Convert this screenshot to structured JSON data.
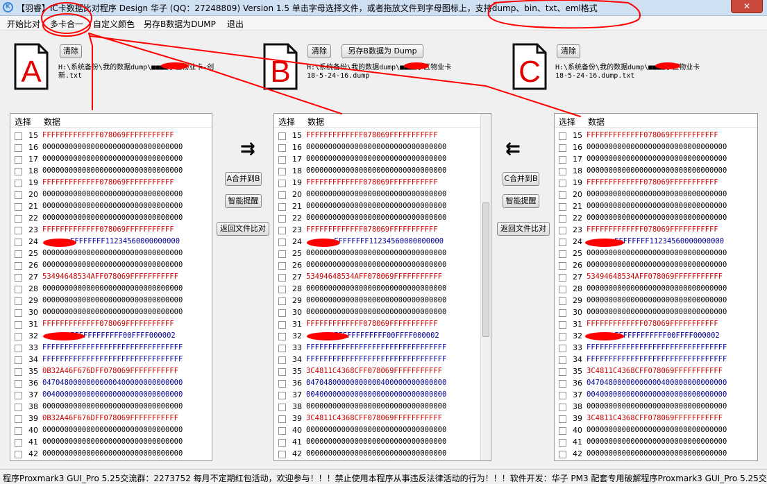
{
  "window": {
    "title": "【羽睿】IC卡数据比对程序  Design 华子 (QQ：27248809)  Version 1.5    单击字母选择文件，或者拖放文件到字母图标上，支持dump、bin、txt、eml格式",
    "close_label": "✕"
  },
  "menu": [
    "开始比对",
    "多卡合一",
    "自定义颜色",
    "另存B数据为DUMP",
    "退出"
  ],
  "slots": {
    "a": {
      "letter": "A",
      "clear": "清除",
      "path_line1": "H:\\系统备份\\我的数据dump\\■■■■小区物业卡-创",
      "path_line2": "新.txt"
    },
    "b": {
      "letter": "B",
      "clear": "清除",
      "save": "另存B数据为 Dump",
      "path_line1": "H:\\系统备份\\我的数据dump\\■■■■小区物业卡",
      "path_line2": "18-5-24-16.dump"
    },
    "c": {
      "letter": "C",
      "clear": "清除",
      "path_line1": "H:\\系统备份\\我的数据dump\\■■■■小区物业卡",
      "path_line2": "18-5-24-16.dump.txt"
    }
  },
  "columns": {
    "select": "选择",
    "data": "数据"
  },
  "middle_left": {
    "arrow": "⇉",
    "merge": "A合并到B",
    "smart": "智能提醒",
    "back": "返回文件比对"
  },
  "middle_right": {
    "arrow": "⇇",
    "merge": "C合并到B",
    "smart": "智能提醒",
    "back": "返回文件比对"
  },
  "colors": {
    "red": "#cc0000",
    "blue": "#000099",
    "black": "#000000",
    "annotation": "#ff0000"
  },
  "panel_a": [
    {
      "n": "15",
      "v": "FFFFFFFFFFFFF078069FFFFFFFFFFF",
      "c": "red"
    },
    {
      "n": "16",
      "v": "00000000000000000000000000000000",
      "c": "black"
    },
    {
      "n": "17",
      "v": "00000000000000000000000000000000",
      "c": "black"
    },
    {
      "n": "18",
      "v": "00000000000000000000000000000000",
      "c": "black"
    },
    {
      "n": "19",
      "v": "FFFFFFFFFFFFF078069FFFFFFFFFFF",
      "c": "red"
    },
    {
      "n": "20",
      "v": "00000000000000000000000000000000",
      "c": "black"
    },
    {
      "n": "21",
      "v": "00000000000000000000000000000000",
      "c": "black"
    },
    {
      "n": "22",
      "v": "00000000000000000000000000000000",
      "c": "black"
    },
    {
      "n": "23",
      "v": "FFFFFFFFFFFFF078069FFFFFFFFFFF",
      "c": "red"
    },
    {
      "n": "24",
      "v": "FFFFFFFF11234560000000000",
      "c": "blue",
      "redacted": true
    },
    {
      "n": "25",
      "v": "00000000000000000000000000000000",
      "c": "black"
    },
    {
      "n": "26",
      "v": "00000000000000000000000000000000",
      "c": "black"
    },
    {
      "n": "27",
      "v": "53494648534AFF078069FFFFFFFFFFF",
      "c": "red"
    },
    {
      "n": "28",
      "v": "00000000000000000000000000000000",
      "c": "black"
    },
    {
      "n": "29",
      "v": "00000000000000000000000000000000",
      "c": "black"
    },
    {
      "n": "30",
      "v": "00000000000000000000000000000000",
      "c": "black"
    },
    {
      "n": "31",
      "v": "FFFFFFFFFFFFF078069FFFFFFFFFFF",
      "c": "red"
    },
    {
      "n": "32",
      "v": "FFFFFFFFFFFF00FFFF000002",
      "c": "blue",
      "redacted": true
    },
    {
      "n": "33",
      "v": "FFFFFFFFFFFFFFFFFFFFFFFFFFFFFFFF",
      "c": "blue"
    },
    {
      "n": "34",
      "v": "FFFFFFFFFFFFFFFFFFFFFFFFFFFFFFFF",
      "c": "blue"
    },
    {
      "n": "35",
      "v": "0B32A46F676DFF078069FFFFFFFFFFF",
      "c": "red"
    },
    {
      "n": "36",
      "v": "04704800000000000400000000000000",
      "c": "blue"
    },
    {
      "n": "37",
      "v": "00400000000000000000000000000000",
      "c": "blue"
    },
    {
      "n": "38",
      "v": "00000000000000000000000000000000",
      "c": "black"
    },
    {
      "n": "39",
      "v": "0B32A46F676DFF078069FFFFFFFFFFF",
      "c": "red"
    },
    {
      "n": "40",
      "v": "00000000000000000000000000000000",
      "c": "black"
    },
    {
      "n": "41",
      "v": "00000000000000000000000000000000",
      "c": "black"
    },
    {
      "n": "42",
      "v": "00000000000000000000000000000000",
      "c": "black"
    }
  ],
  "panel_b": [
    {
      "n": "15",
      "v": "FFFFFFFFFFFFF078069FFFFFFFFFFF",
      "c": "red"
    },
    {
      "n": "16",
      "v": "00000000000000000000000000000000",
      "c": "black"
    },
    {
      "n": "17",
      "v": "00000000000000000000000000000000",
      "c": "black"
    },
    {
      "n": "18",
      "v": "00000000000000000000000000000000",
      "c": "black"
    },
    {
      "n": "19",
      "v": "FFFFFFFFFFFFF078069FFFFFFFFFFF",
      "c": "red"
    },
    {
      "n": "20",
      "v": "00000000000000000000000000000000",
      "c": "black"
    },
    {
      "n": "21",
      "v": "00000000000000000000000000000000",
      "c": "black"
    },
    {
      "n": "22",
      "v": "00000000000000000000000000000000",
      "c": "black"
    },
    {
      "n": "23",
      "v": "FFFFFFFFFFFFF078069FFFFFFFFFFF",
      "c": "red"
    },
    {
      "n": "24",
      "v": "FFFFFFFF11234560000000000",
      "c": "blue",
      "redacted": true
    },
    {
      "n": "25",
      "v": "00000000000000000000000000000000",
      "c": "black"
    },
    {
      "n": "26",
      "v": "00000000000000000000000000000000",
      "c": "black"
    },
    {
      "n": "27",
      "v": "53494648534AFF078069FFFFFFFFFFF",
      "c": "red"
    },
    {
      "n": "28",
      "v": "00000000000000000000000000000000",
      "c": "black"
    },
    {
      "n": "29",
      "v": "00000000000000000000000000000000",
      "c": "black"
    },
    {
      "n": "30",
      "v": "00000000000000000000000000000000",
      "c": "black"
    },
    {
      "n": "31",
      "v": "FFFFFFFFFFFFF078069FFFFFFFFFFF",
      "c": "red"
    },
    {
      "n": "32",
      "v": "FFFFFFFFFFFF00FFFF000002",
      "c": "blue",
      "redacted": true
    },
    {
      "n": "33",
      "v": "FFFFFFFFFFFFFFFFFFFFFFFFFFFFFFFF",
      "c": "blue"
    },
    {
      "n": "34",
      "v": "FFFFFFFFFFFFFFFFFFFFFFFFFFFFFFFF",
      "c": "blue"
    },
    {
      "n": "35",
      "v": "3C4811C4368CFF078069FFFFFFFFFFF",
      "c": "red"
    },
    {
      "n": "36",
      "v": "04704800000000000400000000000000",
      "c": "blue"
    },
    {
      "n": "37",
      "v": "00400000000000000000000000000000",
      "c": "blue"
    },
    {
      "n": "38",
      "v": "00000000000000000000000000000000",
      "c": "black"
    },
    {
      "n": "39",
      "v": "3C4811C4368CFF078069FFFFFFFFFFF",
      "c": "red"
    },
    {
      "n": "40",
      "v": "00000000000000000000000000000000",
      "c": "black"
    },
    {
      "n": "41",
      "v": "00000000000000000000000000000000",
      "c": "black"
    },
    {
      "n": "42",
      "v": "00000000000000000000000000000000",
      "c": "black"
    }
  ],
  "panel_c": [
    {
      "n": "15",
      "v": "FFFFFFFFFFFFF078069FFFFFFFFFFF",
      "c": "red"
    },
    {
      "n": "16",
      "v": "00000000000000000000000000000000",
      "c": "black"
    },
    {
      "n": "17",
      "v": "00000000000000000000000000000000",
      "c": "black"
    },
    {
      "n": "18",
      "v": "00000000000000000000000000000000",
      "c": "black"
    },
    {
      "n": "19",
      "v": "FFFFFFFFFFFFF078069FFFFFFFFFFF",
      "c": "red"
    },
    {
      "n": "20",
      "v": "00000000000000000000000000000000",
      "c": "black"
    },
    {
      "n": "21",
      "v": "00000000000000000000000000000000",
      "c": "black"
    },
    {
      "n": "22",
      "v": "00000000000000000000000000000000",
      "c": "black"
    },
    {
      "n": "23",
      "v": "FFFFFFFFFFFFF078069FFFFFFFFFFF",
      "c": "red"
    },
    {
      "n": "24",
      "v": "FFFFFFFF11234560000000000",
      "c": "blue",
      "redacted": true
    },
    {
      "n": "25",
      "v": "00000000000000000000000000000000",
      "c": "black"
    },
    {
      "n": "26",
      "v": "00000000000000000000000000000000",
      "c": "black"
    },
    {
      "n": "27",
      "v": "53494648534AFF078069FFFFFFFFFFF",
      "c": "red"
    },
    {
      "n": "28",
      "v": "00000000000000000000000000000000",
      "c": "black"
    },
    {
      "n": "29",
      "v": "00000000000000000000000000000000",
      "c": "black"
    },
    {
      "n": "30",
      "v": "00000000000000000000000000000000",
      "c": "black"
    },
    {
      "n": "31",
      "v": "FFFFFFFFFFFFF078069FFFFFFFFFFF",
      "c": "red"
    },
    {
      "n": "32",
      "v": "FFFFFFFFFFFF00FFFF000002",
      "c": "blue",
      "redacted": true
    },
    {
      "n": "33",
      "v": "FFFFFFFFFFFFFFFFFFFFFFFFFFFFFFFF",
      "c": "blue"
    },
    {
      "n": "34",
      "v": "FFFFFFFFFFFFFFFFFFFFFFFFFFFFFFFF",
      "c": "blue"
    },
    {
      "n": "35",
      "v": "3C4811C4368CFF078069FFFFFFFFFFF",
      "c": "red"
    },
    {
      "n": "36",
      "v": "04704800000000000400000000000000",
      "c": "blue"
    },
    {
      "n": "37",
      "v": "00400000000000000000000000000000",
      "c": "blue"
    },
    {
      "n": "38",
      "v": "00000000000000000000000000000000",
      "c": "black"
    },
    {
      "n": "39",
      "v": "3C4811C4368CFF078069FFFFFFFFFFF",
      "c": "red"
    },
    {
      "n": "40",
      "v": "00000000000000000000000000000000",
      "c": "black"
    },
    {
      "n": "41",
      "v": "00000000000000000000000000000000",
      "c": "black"
    },
    {
      "n": "42",
      "v": "00000000000000000000000000000000",
      "c": "black"
    }
  ],
  "status": "程序Proxmark3 GUI_Pro 5.25交流群：2273752 每月不定期红包活动，欢迎参与！！！禁止使用本程序从事违反法律活动的行为！！！软件开发：华子  PM3 配套专用破解程序Proxmark3 GUI_Pro 5.25交"
}
